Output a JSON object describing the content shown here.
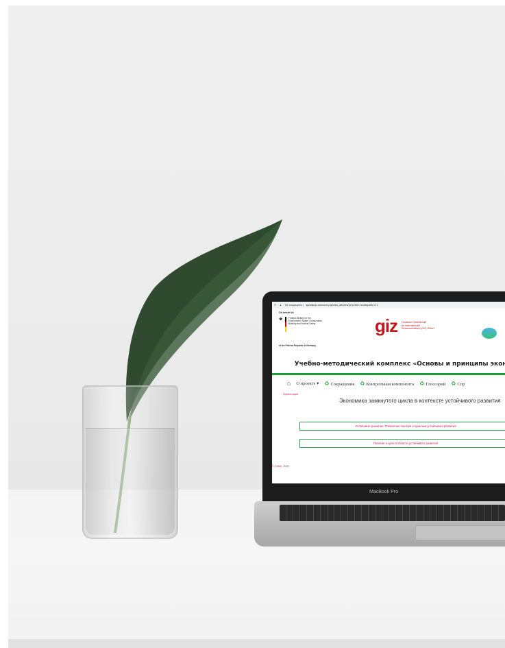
{
  "colors": {
    "green": "#1f9c3a",
    "giz_red": "#c3161c",
    "link": "#c2185b"
  },
  "laptop": {
    "brand_label": "MacBook Pro"
  },
  "browser": {
    "security_label": "Не защищено",
    "url": "кринфор-консалт.рф/cles_all/view.php?file=/sctdepath=0.1"
  },
  "page": {
    "on_behalf": "On behalf of:",
    "ministry_lines": [
      "Federal Ministry for the",
      "Environment, Nature Conservation,",
      "Building and Nuclear Safety"
    ],
    "frg": "of the Federal Republic of Germany",
    "giz_mark": "giz",
    "giz_lines": [
      "Deutsche Gesellschaft",
      "für Internationale",
      "Zusammenarbeit (GIZ) GmbH"
    ],
    "title": "Учебно-методический комплекс «Основы и принципы экономики замкнут",
    "menu": {
      "about": "О проекте",
      "abbreviations": "Сокращения",
      "control": "Контрольная компонента",
      "glossary": "Глоссарий",
      "reference": "Спр"
    },
    "breadcrumb": "Презентации",
    "heading": "Экономика замкнутого цикла в контексте устойчивого развития",
    "links": [
      "Устойчивое развитие. Появление понятия и практики устойчивого развития",
      "Понятие и цели в области устойчивого развития"
    ],
    "copyright_prefix": "© ",
    "copyright_link": "Gmbh",
    "copyright_year": ", 2020"
  }
}
